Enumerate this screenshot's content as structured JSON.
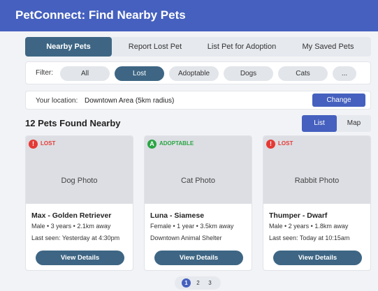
{
  "app": {
    "title": "PetConnect: Find Nearby Pets"
  },
  "tabs": [
    {
      "label": "Nearby Pets",
      "active": true
    },
    {
      "label": "Report Lost Pet",
      "active": false
    },
    {
      "label": "List Pet for Adoption",
      "active": false
    },
    {
      "label": "My Saved Pets",
      "active": false
    }
  ],
  "filter": {
    "label": "Filter:",
    "chips": [
      {
        "label": "All",
        "active": false
      },
      {
        "label": "Lost",
        "active": true
      },
      {
        "label": "Adoptable",
        "active": false
      },
      {
        "label": "Dogs",
        "active": false
      },
      {
        "label": "Cats",
        "active": false
      },
      {
        "label": "...",
        "active": false
      }
    ]
  },
  "location": {
    "label": "Your location:",
    "value": "Downtown Area (5km radius)",
    "change_label": "Change"
  },
  "results": {
    "title": "12 Pets Found Nearby",
    "view_toggle": [
      {
        "label": "List",
        "active": true
      },
      {
        "label": "Map",
        "active": false
      }
    ]
  },
  "pets": [
    {
      "status": "LOST",
      "status_icon": "!",
      "status_color": "#e53935",
      "photo_label": "Dog Photo",
      "name": "Max - Golden Retriever",
      "meta": "Male • 3 years • 2.1km away",
      "extra": "Last seen: Yesterday at 4:30pm",
      "button_label": "View Details"
    },
    {
      "status": "ADOPTABLE",
      "status_icon": "A",
      "status_color": "#2aa544",
      "photo_label": "Cat Photo",
      "name": "Luna - Siamese",
      "meta": "Female • 1 year • 3.5km away",
      "extra": "Downtown Animal Shelter",
      "button_label": "View Details"
    },
    {
      "status": "LOST",
      "status_icon": "!",
      "status_color": "#e53935",
      "photo_label": "Rabbit Photo",
      "name": "Thumper - Dwarf",
      "meta": "Male • 2 years • 1.8km away",
      "extra": "Last seen: Today at 10:15am",
      "button_label": "View Details"
    }
  ],
  "pagination": {
    "pages": [
      {
        "label": "1",
        "active": true
      },
      {
        "label": "2",
        "active": false
      },
      {
        "label": "3",
        "active": false
      }
    ]
  },
  "colors": {
    "header": "#4560be",
    "primary": "#4560be",
    "accent_dark": "#3e6684",
    "lost": "#e53935",
    "adoptable": "#2aa544"
  }
}
